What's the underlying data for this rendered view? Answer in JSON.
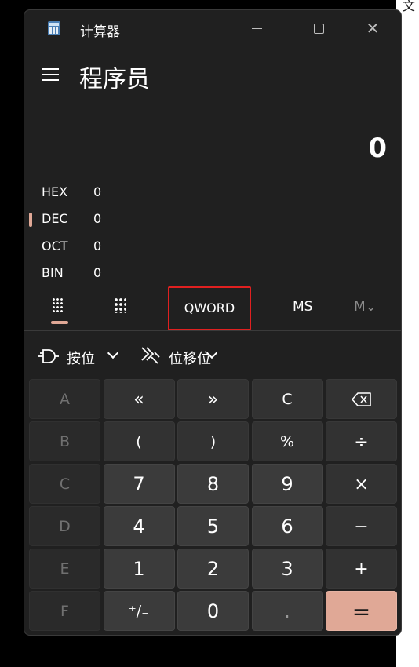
{
  "title_bar": {
    "app_name": "计算器",
    "minimize": "",
    "maximize": "",
    "close": "✕"
  },
  "mode_title": "程序员",
  "display_value": "0",
  "radix_list": [
    {
      "name": "HEX",
      "value": "0",
      "active": false
    },
    {
      "name": "DEC",
      "value": "0",
      "active": true
    },
    {
      "name": "OCT",
      "value": "0",
      "active": false
    },
    {
      "name": "BIN",
      "value": "0",
      "active": false
    }
  ],
  "toolbar": {
    "word_size": "QWORD",
    "memory_store": "MS",
    "memory_dropdown": "M⌄"
  },
  "dropdowns": {
    "bitwise": "按位",
    "bit_shift": "位移位"
  },
  "keys": [
    [
      "A",
      "«",
      "»",
      "C",
      "⌫"
    ],
    [
      "B",
      "(",
      ")",
      "%",
      "÷"
    ],
    [
      "C",
      "7",
      "8",
      "9",
      "×"
    ],
    [
      "D",
      "4",
      "5",
      "6",
      "−"
    ],
    [
      "E",
      "1",
      "2",
      "3",
      "+"
    ],
    [
      "F",
      "⁺∕₋",
      "0",
      ".",
      "="
    ]
  ],
  "colors": {
    "accent": "#e0a896",
    "background": "#202020",
    "highlight_box": "#e02020"
  }
}
